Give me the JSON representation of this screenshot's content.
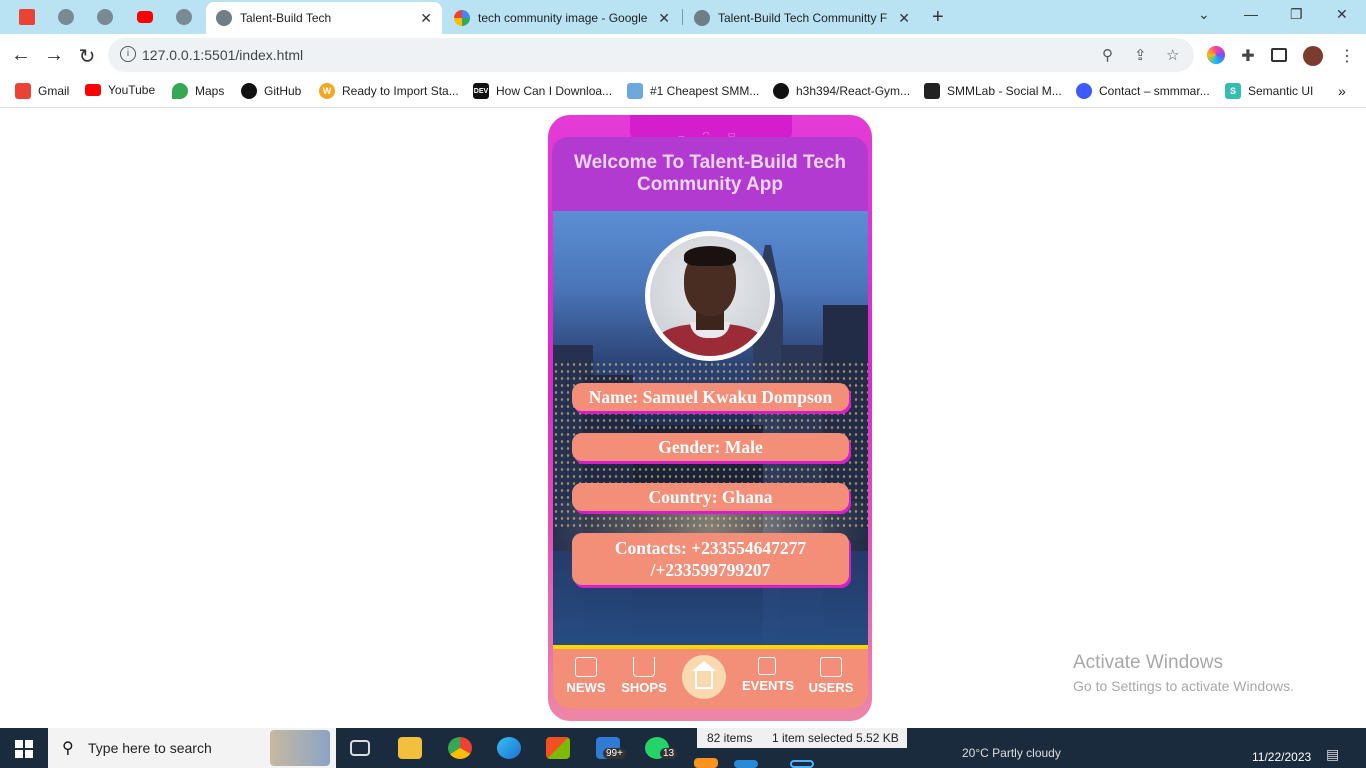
{
  "browser": {
    "tabs": [
      {
        "title": "Talent-Build Tech",
        "active": true
      },
      {
        "title": "tech community image - Google",
        "active": false
      },
      {
        "title": "Talent-Build Tech Communitty F",
        "active": false
      }
    ],
    "url": "127.0.0.1:5501/index.html",
    "bookmarks": [
      {
        "label": "Gmail",
        "icon": "gmail-icon"
      },
      {
        "label": "YouTube",
        "icon": "youtube-icon"
      },
      {
        "label": "Maps",
        "icon": "maps-icon"
      },
      {
        "label": "GitHub",
        "icon": "github-icon"
      },
      {
        "label": "Ready to Import Sta...",
        "icon": "w-icon"
      },
      {
        "label": "How Can I Downloa...",
        "icon": "dev-icon"
      },
      {
        "label": "#1 Cheapest SMM...",
        "icon": "smm-icon"
      },
      {
        "label": "h3h394/React-Gym...",
        "icon": "github-icon"
      },
      {
        "label": "SMMLab - Social M...",
        "icon": "smmlab-icon"
      },
      {
        "label": "Contact – smmmar...",
        "icon": "contact-icon"
      },
      {
        "label": "Semantic UI",
        "icon": "semantic-icon"
      }
    ],
    "dev_icon_text": "DEV",
    "more_bookmarks": "»"
  },
  "app": {
    "title": "Welcome To Talent-Build Tech Community App",
    "profile": {
      "name": "Name: Samuel Kwaku Dompson",
      "gender": "Gender: Male",
      "country": "Country: Ghana",
      "contacts": "Contacts: +233554647277 /+233599799207"
    },
    "nav": [
      {
        "label": "NEWS",
        "icon": "news-icon"
      },
      {
        "label": "SHOPS",
        "icon": "cart-icon"
      },
      {
        "label": "",
        "icon": "home-icon"
      },
      {
        "label": "EVENTS",
        "icon": "calendar-icon"
      },
      {
        "label": "USERS",
        "icon": "users-icon"
      }
    ],
    "colors": {
      "frame": "#e43ad6",
      "header": "#b23ad0",
      "pill": "#f38e78",
      "pill_shadow": "#d51fc9",
      "nav_top": "#ffd400"
    }
  },
  "watermark": {
    "line1": "Activate Windows",
    "line2": "Go to Settings to activate Windows."
  },
  "taskbar": {
    "search_placeholder": "Type here to search",
    "mail_badge": "99+",
    "whatsapp_badge": "13",
    "explorer_items": "82 items",
    "explorer_selected": "1 item selected  5.52 KB",
    "weather": "20°C  Partly cloudy",
    "date": "11/22/2023"
  }
}
